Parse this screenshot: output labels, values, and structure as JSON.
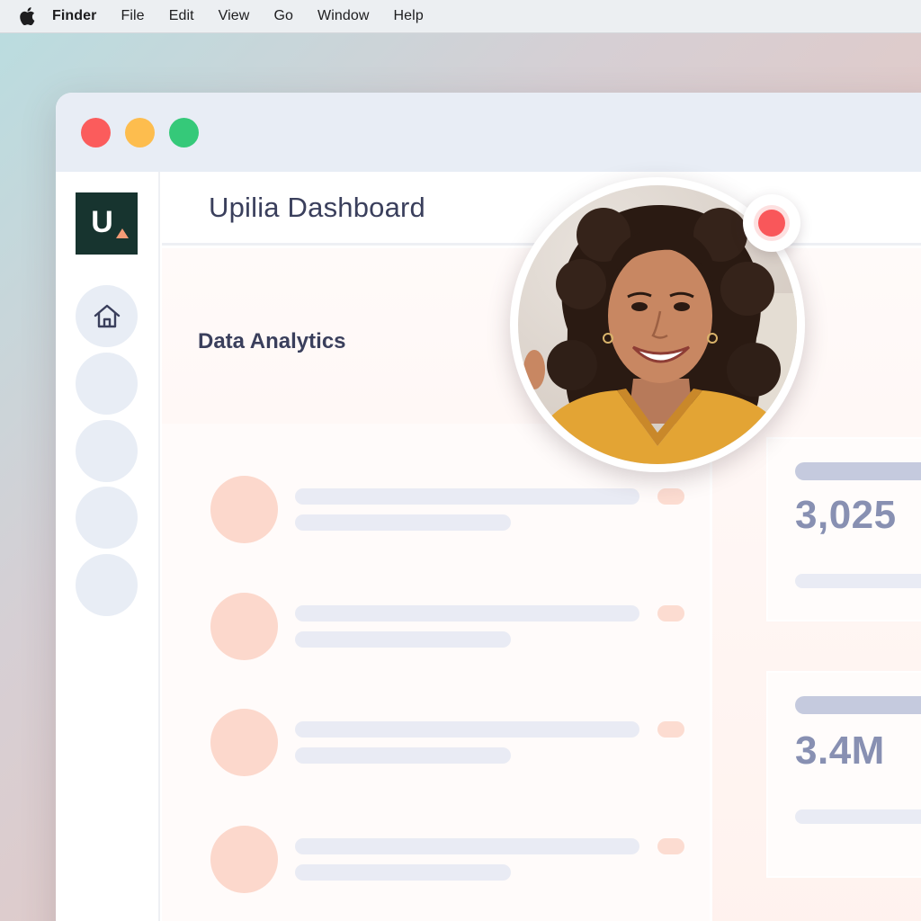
{
  "menubar": {
    "app_name": "Finder",
    "items": [
      "File",
      "Edit",
      "View",
      "Go",
      "Window",
      "Help"
    ]
  },
  "window": {
    "traffic_lights": {
      "close": "#fb5c5c",
      "minimize": "#fdbd4e",
      "zoom": "#35c979"
    }
  },
  "sidebar": {
    "logo_letter": "U",
    "logo_color": "#17342f",
    "logo_accent": "#f59b76",
    "nav_icons": [
      "home-icon",
      "",
      "",
      "",
      ""
    ]
  },
  "header": {
    "title": "Upilia Dashboard"
  },
  "main": {
    "section_title": "Data Analytics",
    "list_rows": 4,
    "stats": [
      {
        "value": "3,025"
      },
      {
        "value": "3.4M"
      }
    ]
  },
  "video_call": {
    "recording_indicator": "red-dot",
    "recording_color": "#f9575a"
  }
}
